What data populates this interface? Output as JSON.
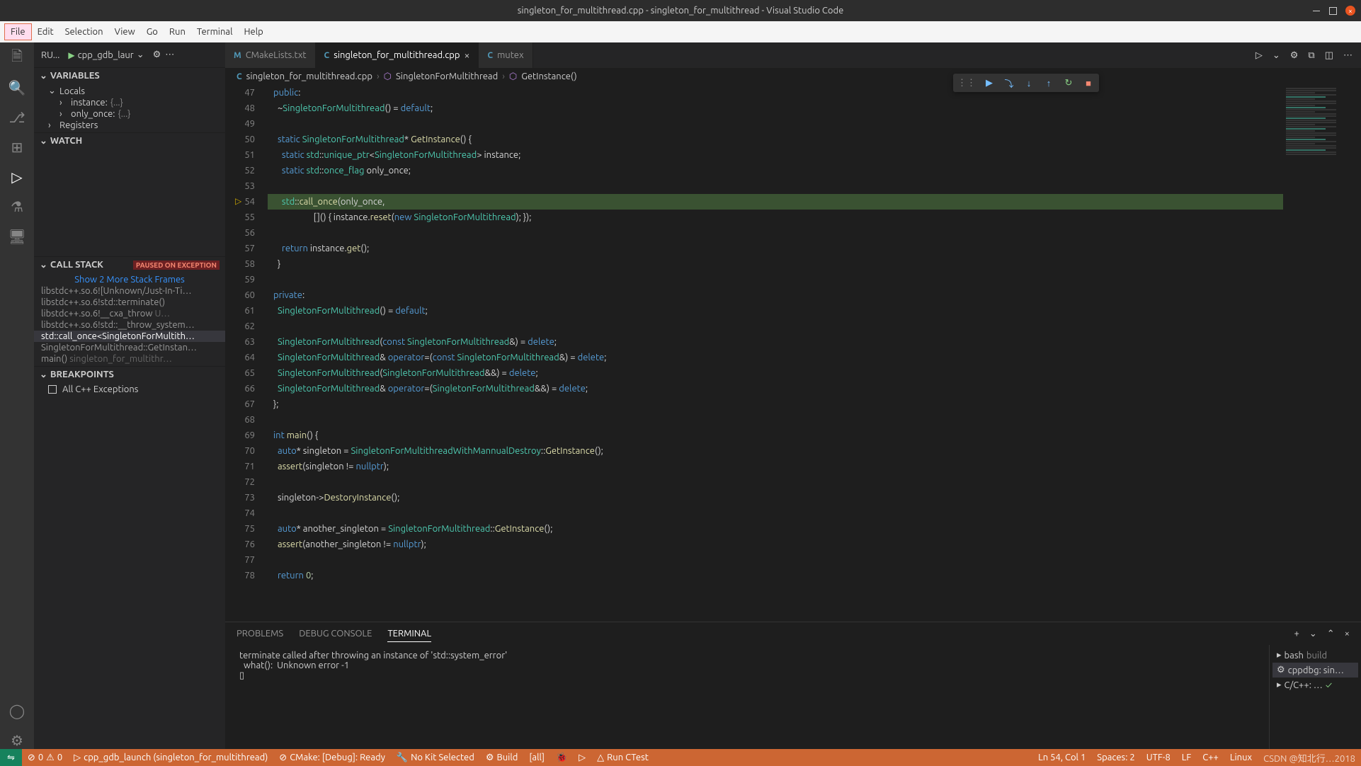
{
  "title": "singleton_for_multithread.cpp - singleton_for_multithread - Visual Studio Code",
  "menu": [
    "File",
    "Edit",
    "Selection",
    "View",
    "Go",
    "Run",
    "Terminal",
    "Help"
  ],
  "debugTop": {
    "run": "RU...",
    "config": "cpp_gdb_laur"
  },
  "sections": {
    "variables": "Variables",
    "locals": "Locals",
    "instance": "instance:",
    "instance_val": "{...}",
    "only_once": "only_once:",
    "only_once_val": "{...}",
    "registers": "Registers",
    "watch": "Watch",
    "callstack": "Call Stack",
    "paused": "Paused on Exception",
    "breakpoints": "Breakpoints",
    "allcpp": "All C++ Exceptions"
  },
  "stack": {
    "more": "Show 2 More Stack Frames",
    "f0": "libstdc++.so.6![Unknown/Just-In-Ti…",
    "f1": "libstdc++.so.6!std::terminate()",
    "f2": "libstdc++.so.6!__cxa_throw",
    "f2d": "U…",
    "f3": "libstdc++.so.6!std::__throw_system…",
    "f4": "std::call_once<SingletonForMultith…",
    "f5": "SingletonForMultithread::GetInstan…",
    "f6": "main()",
    "f6d": "singleton_for_multithr…"
  },
  "tabs": {
    "cmake": "CMakeLists.txt",
    "main": "singleton_for_multithread.cpp",
    "mutex": "mutex"
  },
  "breadcrumb": {
    "file": "singleton_for_multithread.cpp",
    "class": "SingletonForMultithread",
    "method": "GetInstance()"
  },
  "panelTabs": {
    "problems": "Problems",
    "debug": "Debug Console",
    "terminal": "Terminal"
  },
  "terminal": {
    "l1": "terminate called after throwing an instance of 'std::system_error'",
    "l2": "  what():  Unknown error -1",
    "side": {
      "bash": "bash",
      "bashd": "build",
      "cppdbg": "cppdbg: sin…",
      "cpp": "C/C++: …"
    }
  },
  "status": {
    "errors": "0",
    "warnings": "0",
    "launch": "cpp_gdb_launch (singleton_for_multithread)",
    "cmake": "CMake: [Debug]: Ready",
    "kit": "No Kit Selected",
    "build": "Build",
    "all": "[all]",
    "ctest": "Run CTest",
    "pos": "Ln 54, Col 1",
    "spaces": "Spaces: 2",
    "enc": "UTF-8",
    "eol": "LF",
    "lang": "C++",
    "linux": "Linux",
    "watermark": "CSDN @知北行…2018"
  },
  "chart_data": {
    "type": "table",
    "title": "Editor source lines",
    "lines": [
      {
        "n": 47,
        "t": "public:"
      },
      {
        "n": 48,
        "t": "  ~SingletonForMultithread() = default;"
      },
      {
        "n": 49,
        "t": ""
      },
      {
        "n": 50,
        "t": "  static SingletonForMultithread* GetInstance() {"
      },
      {
        "n": 51,
        "t": "    static std::unique_ptr<SingletonForMultithread> instance;"
      },
      {
        "n": 52,
        "t": "    static std::once_flag only_once;"
      },
      {
        "n": 53,
        "t": ""
      },
      {
        "n": 54,
        "t": "    std::call_once(only_once,",
        "hl": true,
        "bp": true
      },
      {
        "n": 55,
        "t": "                   []() { instance.reset(new SingletonForMultithread); });"
      },
      {
        "n": 56,
        "t": ""
      },
      {
        "n": 57,
        "t": "    return instance.get();"
      },
      {
        "n": 58,
        "t": "  }"
      },
      {
        "n": 59,
        "t": ""
      },
      {
        "n": 60,
        "t": "private:"
      },
      {
        "n": 61,
        "t": "  SingletonForMultithread() = default;"
      },
      {
        "n": 62,
        "t": ""
      },
      {
        "n": 63,
        "t": "  SingletonForMultithread(const SingletonForMultithread&) = delete;"
      },
      {
        "n": 64,
        "t": "  SingletonForMultithread& operator=(const SingletonForMultithread&) = delete;"
      },
      {
        "n": 65,
        "t": "  SingletonForMultithread(SingletonForMultithread&&) = delete;"
      },
      {
        "n": 66,
        "t": "  SingletonForMultithread& operator=(SingletonForMultithread&&) = delete;"
      },
      {
        "n": 67,
        "t": "};"
      },
      {
        "n": 68,
        "t": ""
      },
      {
        "n": 69,
        "t": "int main() {"
      },
      {
        "n": 70,
        "t": "  auto* singleton = SingletonForMultithreadWithMannualDestroy::GetInstance();"
      },
      {
        "n": 71,
        "t": "  assert(singleton != nullptr);"
      },
      {
        "n": 72,
        "t": ""
      },
      {
        "n": 73,
        "t": "  singleton->DestoryInstance();"
      },
      {
        "n": 74,
        "t": ""
      },
      {
        "n": 75,
        "t": "  auto* another_singleton = SingletonForMultithread::GetInstance();"
      },
      {
        "n": 76,
        "t": "  assert(another_singleton != nullptr);"
      },
      {
        "n": 77,
        "t": ""
      },
      {
        "n": 78,
        "t": "  return 0;"
      }
    ]
  }
}
